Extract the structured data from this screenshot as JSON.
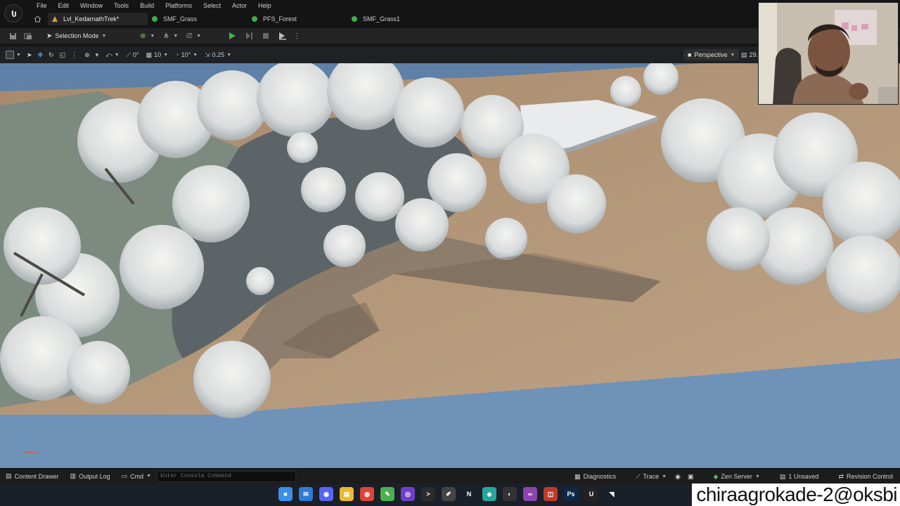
{
  "menu": {
    "items": [
      "File",
      "Edit",
      "Window",
      "Tools",
      "Build",
      "Platforms",
      "Select",
      "Actor",
      "Help"
    ]
  },
  "tabs": [
    {
      "label": "Lvl_KedarnathTrek*",
      "color": "#d9a13b",
      "active": true
    },
    {
      "label": "SMF_Grass",
      "color": "#3fb04a",
      "active": false
    },
    {
      "label": "PFS_Forest",
      "color": "#3fb04a",
      "active": false
    },
    {
      "label": "SMF_Grass1",
      "color": "#3fb04a",
      "active": false
    }
  ],
  "toolbar": {
    "selection_mode": "Selection Mode"
  },
  "viewport_bar": {
    "grid_snap": "0°",
    "location_snap": "10",
    "rotation_snap": "10°",
    "scale_snap": "0.25",
    "view_mode": "Perspective",
    "fov": "29."
  },
  "bottom_bar": {
    "content_drawer": "Content Drawer",
    "output_log": "Output Log",
    "cmd": "Cmd",
    "console_placeholder": "Enter Console Command",
    "diagnostics": "Diagnostics",
    "trace": "Trace",
    "zen_server": "Zen Server",
    "unsaved": "1 Unsaved",
    "revision_control": "Revision Control"
  },
  "taskbar": {
    "apps": [
      {
        "name": "windows-start-icon",
        "color": "#3a8fe6",
        "glyph": "■"
      },
      {
        "name": "mail-icon",
        "color": "#2d7cd6",
        "glyph": "✉"
      },
      {
        "name": "discord-icon",
        "color": "#5865f2",
        "glyph": "◉"
      },
      {
        "name": "file-explorer-icon",
        "color": "#e9b934",
        "glyph": "▤"
      },
      {
        "name": "chrome-icon",
        "color": "#db4437",
        "glyph": "◍"
      },
      {
        "name": "notepad-icon",
        "color": "#4caf50",
        "glyph": "✎"
      },
      {
        "name": "github-icon",
        "color": "#6e40c9",
        "glyph": "◎"
      },
      {
        "name": "terminal-icon",
        "color": "#2b2b2b",
        "glyph": ">"
      },
      {
        "name": "editor-icon",
        "color": "#444",
        "glyph": "✐"
      },
      {
        "name": "netflix-icon",
        "color": "#1b1f27",
        "glyph": "N"
      },
      {
        "name": "app-icon",
        "color": "#26a69a",
        "glyph": "◆"
      },
      {
        "name": "obs-icon",
        "color": "#333",
        "glyph": "◐"
      },
      {
        "name": "visual-studio-icon",
        "color": "#8e44ad",
        "glyph": "∞"
      },
      {
        "name": "recorder-icon",
        "color": "#c0392b",
        "glyph": "◫"
      },
      {
        "name": "photoshop-icon",
        "color": "#0b2a4a",
        "glyph": "Ps"
      },
      {
        "name": "unreal-icon",
        "color": "#222",
        "glyph": "U"
      },
      {
        "name": "nvidia-icon",
        "color": "#1b1f27",
        "glyph": "◥"
      }
    ]
  },
  "watermark": "chiraagrokade-2@oksbi",
  "colors": {
    "sky": "#6f8db0",
    "ground": "#b59a7d",
    "play_button": "#49b14a",
    "chrome_dark": "#141414"
  }
}
